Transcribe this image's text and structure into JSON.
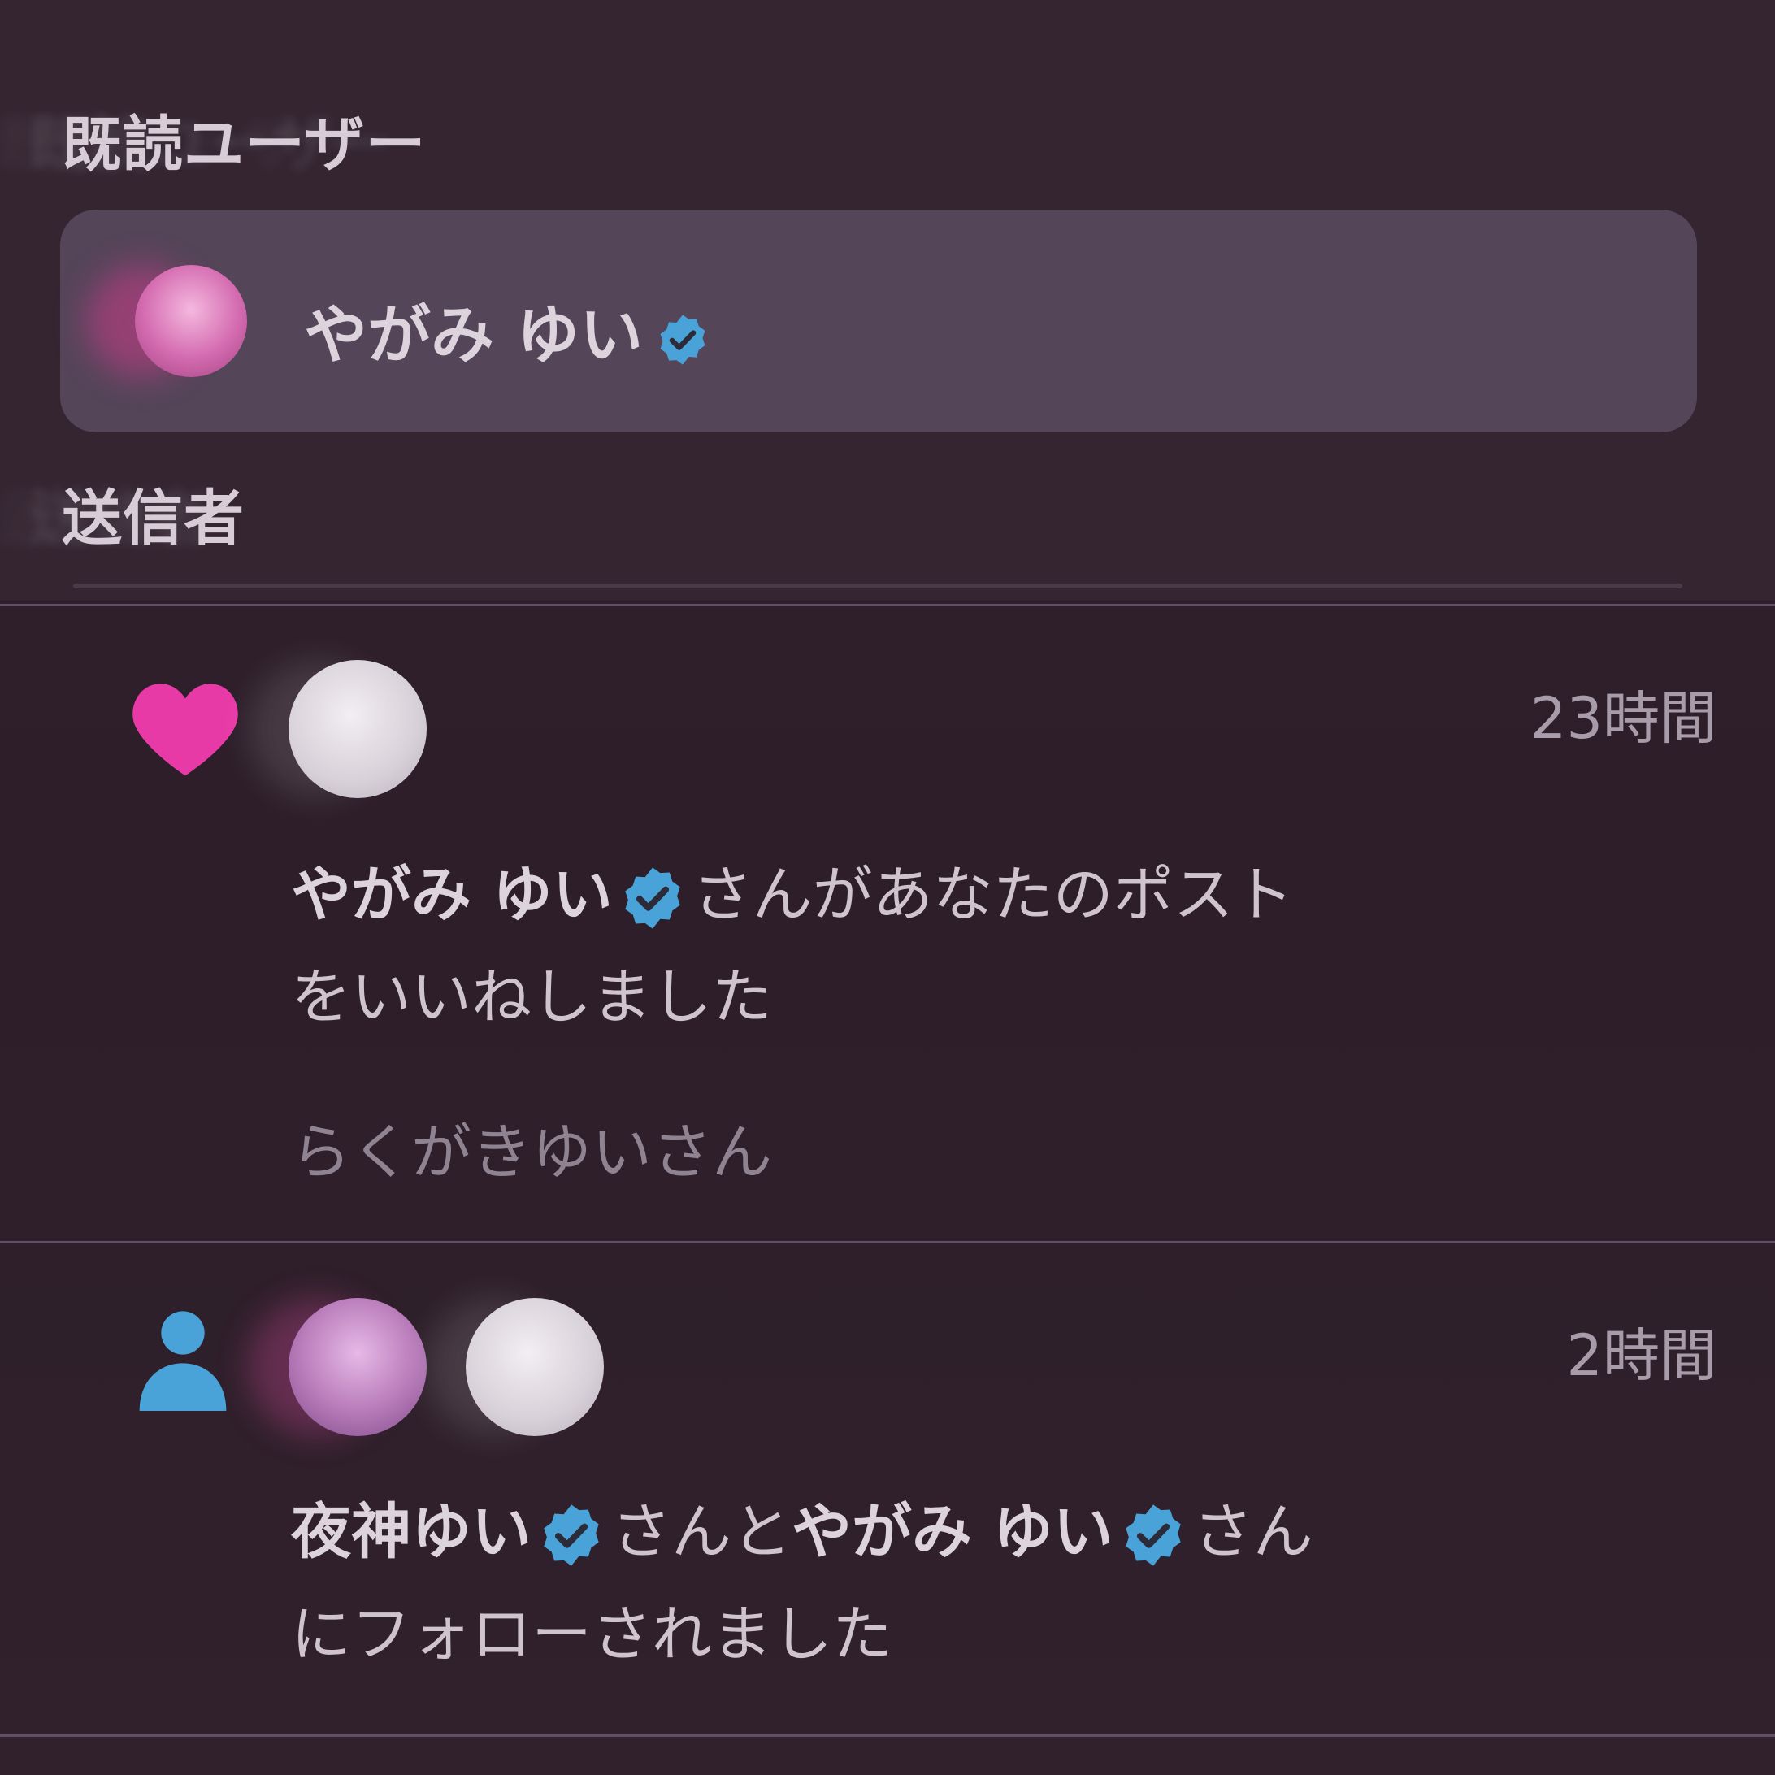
{
  "popover": {
    "read_users_label": "既読ユーザー",
    "reader_name": "やがみ ゆい",
    "sender_label": "送信者"
  },
  "notifications": [
    {
      "icon": "heart-icon",
      "time": "23時間",
      "actor": "やがみ ゆい",
      "message": "さんがあなたのポスト",
      "message_cont": "をいいねしました",
      "sub": "らくがきゆいさん"
    },
    {
      "icon": "follow-person-icon",
      "time": "2時間",
      "actor1": "夜神ゆい",
      "joiner": "さんと",
      "actor2": "やがみ ゆい",
      "message": "さん",
      "message_cont": "にフォローされました"
    }
  ],
  "colors": {
    "verified": "#4aa3d8",
    "heart": "#e83aa7",
    "follow": "#4aa3d8"
  }
}
